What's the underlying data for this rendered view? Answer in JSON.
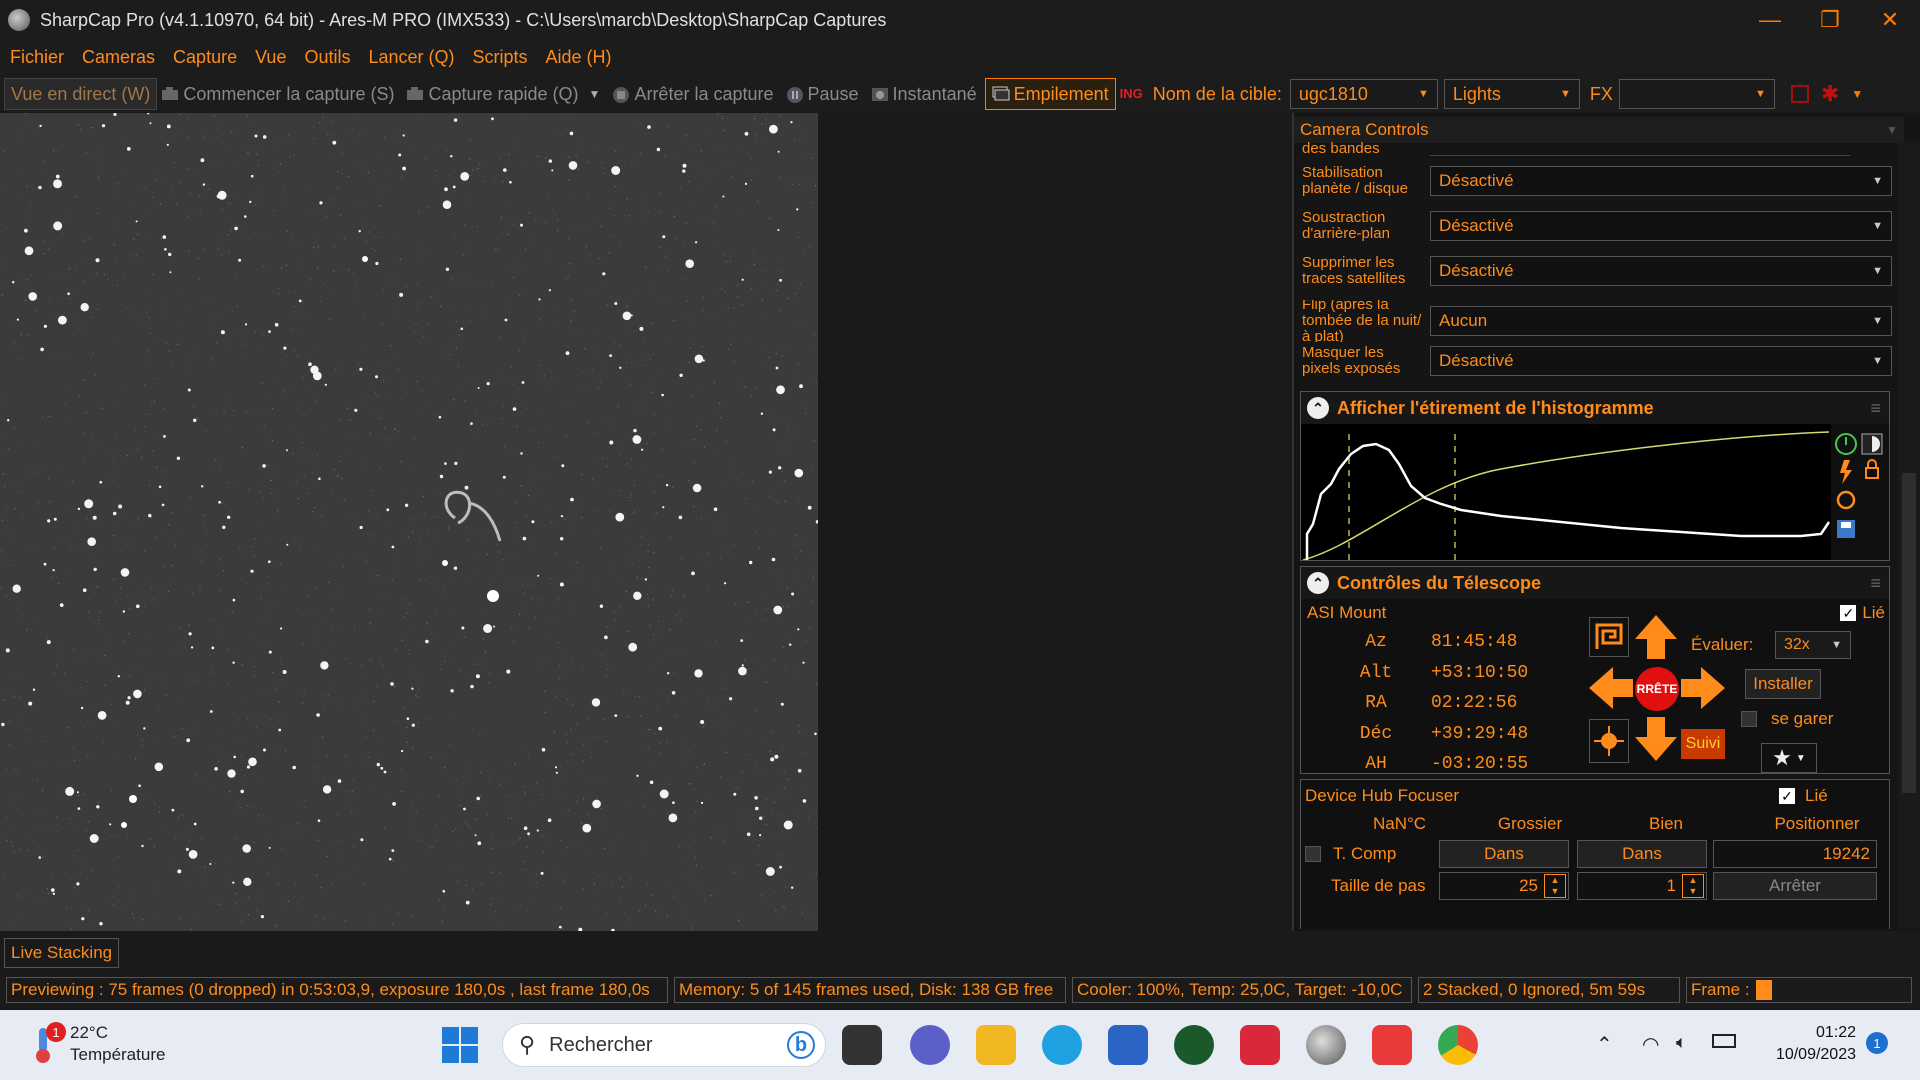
{
  "window": {
    "title": "SharpCap Pro (v4.1.10970, 64 bit) - Ares-M PRO (IMX533) - C:\\Users\\marcb\\Desktop\\SharpCap Captures",
    "min": "—",
    "restore": "❐",
    "close": "✕"
  },
  "menu": [
    "Fichier",
    "Cameras",
    "Capture",
    "Vue",
    "Outils",
    "Lancer (Q)",
    "Scripts",
    "Aide (H)"
  ],
  "toolbar": {
    "live": "Vue en direct (W)",
    "start_capture": "Commencer la capture (S)",
    "quick_capture": "Capture rapide (Q)",
    "stop_capture": "Arrêter la capture",
    "pause": "Pause",
    "snapshot": "Instantané",
    "stacking": "Empilement",
    "target_label": "Nom de la cible:",
    "target_value": "ugc1810",
    "frame_type": "Lights",
    "fx_label": "FX",
    "fx_value": ""
  },
  "panel": {
    "title": "Camera Controls",
    "partial_label": "des bandes",
    "settings": [
      {
        "label": "Stabilisation planète / disque",
        "value": "Désactivé"
      },
      {
        "label": "Soustraction d'arrière-plan",
        "value": "Désactivé"
      },
      {
        "label": "Supprimer les traces satellites",
        "value": "Désactivé"
      },
      {
        "label": "Flip (après la tombée de la nuit/à plat)",
        "value": "Aucun"
      },
      {
        "label": "Masquer les pixels exposés",
        "value": "Désactivé"
      }
    ],
    "histogram": {
      "title": "Afficher l'étirement de l'histogramme"
    },
    "telescope": {
      "title": "Contrôles du Télescope",
      "mount_name": "ASI Mount",
      "linked_label": "Lié",
      "coords": [
        {
          "key": "Az",
          "value": "81:45:48"
        },
        {
          "key": "Alt",
          "value": "+53:10:50"
        },
        {
          "key": "RA",
          "value": "02:22:56"
        },
        {
          "key": "Déc",
          "value": "+39:29:48"
        },
        {
          "key": "AH",
          "value": "-03:20:55"
        }
      ],
      "stop_label": "RRÊTE",
      "rate_label": "Évaluer:",
      "rate_value": "32x",
      "install_label": "Installer",
      "park_label": "se garer",
      "track_label": "Suivi"
    },
    "focuser": {
      "name": "Device Hub Focuser",
      "linked_label": "Lié",
      "temp": "NaN°C",
      "coarse": "Grossier",
      "fine": "Bien",
      "position_label": "Positionner",
      "tcomp_label": "T. Comp",
      "coarse_in": "Dans",
      "fine_in": "Dans",
      "position_value": "19242",
      "step_label": "Taille de pas",
      "coarse_step": "25",
      "fine_step": "1",
      "stop_label": "Arrêter"
    }
  },
  "status": {
    "tab": "Live Stacking",
    "preview": "Previewing : 75 frames (0 dropped) in 0:53:03,9, exposure 180,0s , last frame 180,0s",
    "memory": "Memory: 5 of 145 frames used, Disk: 138 GB free",
    "cooler": "Cooler: 100%, Temp: 25,0C, Target: -10,0C",
    "stacked": "2 Stacked, 0 Ignored, 5m 59s",
    "frame_label": "Frame :"
  },
  "taskbar": {
    "weather_temp": "22°C",
    "weather_label": "Température",
    "weather_badge": "1",
    "search_placeholder": "Rechercher",
    "time": "01:22",
    "date": "10/09/2023",
    "notif_count": "1"
  }
}
